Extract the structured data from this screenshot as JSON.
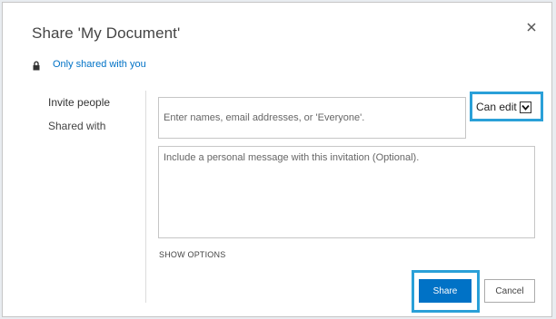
{
  "dialog": {
    "title": "Share 'My Document'",
    "sharing_status": "Only shared with you"
  },
  "nav": {
    "items": [
      {
        "label": "Invite people",
        "selected": true
      },
      {
        "label": "Shared with",
        "selected": false
      }
    ]
  },
  "invite": {
    "names_placeholder": "Enter names, email addresses, or 'Everyone'.",
    "names_value": "",
    "permission_selected": "Can edit",
    "message_placeholder": "Include a personal message with this invitation (Optional).",
    "message_value": "",
    "show_options_label": "SHOW OPTIONS"
  },
  "buttons": {
    "share_label": "Share",
    "cancel_label": "Cancel"
  },
  "icons": {
    "close": "close-icon",
    "lock": "lock-icon",
    "dropdown": "chevron-down-icon"
  },
  "colors": {
    "accent": "#0072c6",
    "highlight": "#2aa0d8",
    "text": "#444444",
    "border": "#c6c6c6"
  }
}
